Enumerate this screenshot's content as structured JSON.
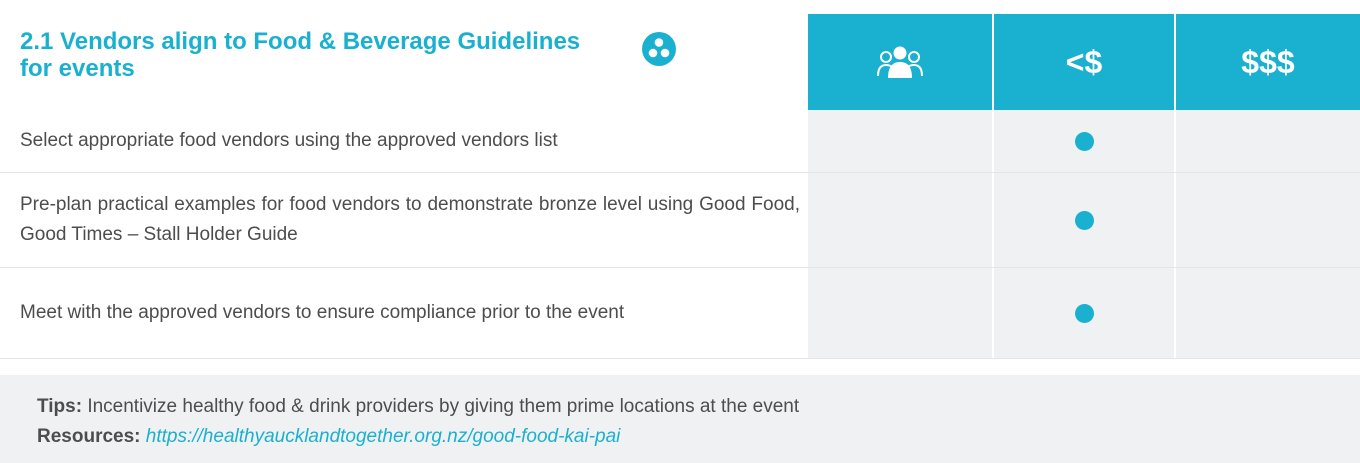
{
  "section": {
    "title": "2.1 Vendors align to Food & Beverage Guidelines for events"
  },
  "columns": {
    "people_icon": "people-group-icon",
    "low_cost": "<$",
    "high_cost": "$$$"
  },
  "rows": [
    {
      "text": "Select appropriate food vendors using the approved vendors list",
      "people": false,
      "low_cost": true,
      "high_cost": false
    },
    {
      "text": "Pre-plan practical examples for food vendors to demonstrate bronze level using Good Food, Good Times – Stall Holder Guide",
      "people": false,
      "low_cost": true,
      "high_cost": false
    },
    {
      "text": "Meet with the approved vendors to ensure compliance prior to the event",
      "people": false,
      "low_cost": true,
      "high_cost": false
    }
  ],
  "tips": {
    "tips_label": "Tips:",
    "tips_text": "Incentivize healthy food & drink providers by giving them prime locations at the event",
    "resources_label": "Resources:",
    "resources_link": "https://healthyaucklandtogether.org.nz/good-food-kai-pai"
  },
  "colors": {
    "accent": "#1ab0d0",
    "cell_bg": "#f0f1f3",
    "text": "#4d4d4d"
  }
}
